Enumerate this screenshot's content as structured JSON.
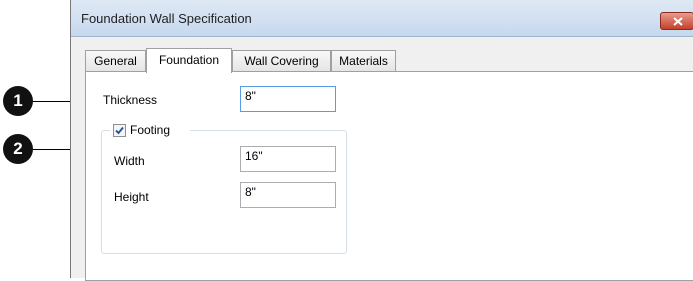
{
  "window": {
    "title": "Foundation Wall Specification"
  },
  "tabs": [
    {
      "label": "General",
      "active": false
    },
    {
      "label": "Foundation",
      "active": true
    },
    {
      "label": "Wall Covering",
      "active": false
    },
    {
      "label": "Materials",
      "active": false
    }
  ],
  "form": {
    "thickness": {
      "label": "Thickness",
      "value": "8\""
    },
    "footing": {
      "label": "Footing",
      "checked": true,
      "width": {
        "label": "Width",
        "value": "16\""
      },
      "height": {
        "label": "Height",
        "value": "8\""
      }
    }
  },
  "callouts": {
    "one": "1",
    "two": "2"
  },
  "colors": {
    "focus_border": "#569de5",
    "close_button": "#c4422c",
    "checkmark": "#1c4fa0"
  },
  "icons": {
    "close": "close-icon",
    "check": "checkmark-icon"
  }
}
